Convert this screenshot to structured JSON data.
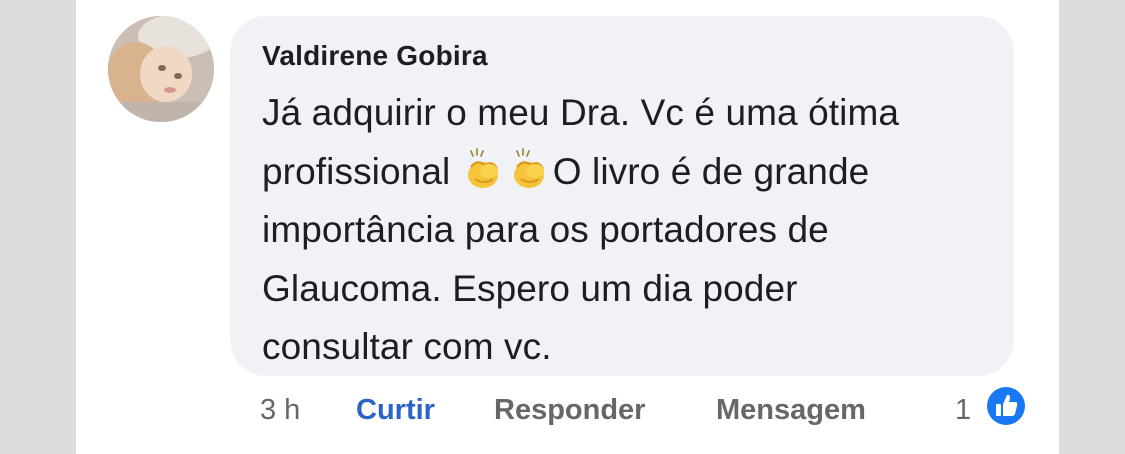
{
  "comment": {
    "author": "Valdirene Gobira",
    "text_line1": "Já adquirir o meu Dra. Vc é uma ótima",
    "text_line2_start": "profissional",
    "text_line2_end": "O livro é de grande",
    "text_line3": "importância para os portadores de",
    "text_line4": "Glaucoma. Espero um dia poder",
    "text_line5": "consultar com vc.",
    "emojis": [
      "clapping-hands-icon",
      "clapping-hands-icon"
    ]
  },
  "actions": {
    "time": "3 h",
    "like_label": "Curtir",
    "reply_label": "Responder",
    "message_label": "Mensagem",
    "reaction_count": "1",
    "reaction_icon": "thumbs-up-icon"
  },
  "colors": {
    "bubble": "#f0f2f5",
    "like_active": "#2d63c5",
    "muted": "#65676b",
    "reaction_blue": "#1877f2"
  }
}
